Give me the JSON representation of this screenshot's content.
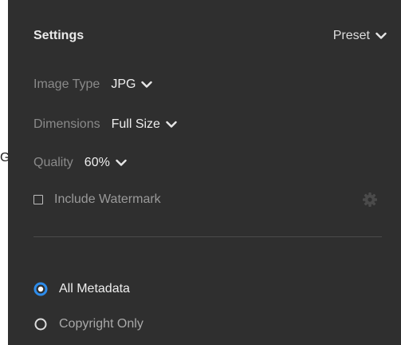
{
  "edge": {
    "text": "G"
  },
  "settings": {
    "title": "Settings",
    "preset": {
      "label": "Preset"
    }
  },
  "fields": {
    "image_type": {
      "label": "Image Type",
      "value": "JPG"
    },
    "dimensions": {
      "label": "Dimensions",
      "value": "Full Size"
    },
    "quality": {
      "label": "Quality",
      "value": "60%"
    }
  },
  "watermark": {
    "label": "Include Watermark",
    "checked": false
  },
  "metadata": {
    "options": [
      {
        "label": "All Metadata",
        "selected": true
      },
      {
        "label": "Copyright Only",
        "selected": false
      }
    ]
  },
  "colors": {
    "panel_bg": "#2f2f2f",
    "accent_blue": "#2d8ceb",
    "text_primary": "#eeeeee",
    "text_muted": "#8a8a8a"
  },
  "icons": {
    "dropdown": "chevron-down-icon",
    "settings": "gear-icon",
    "checkbox": "checkbox-icon",
    "radio": "radio-icon"
  }
}
